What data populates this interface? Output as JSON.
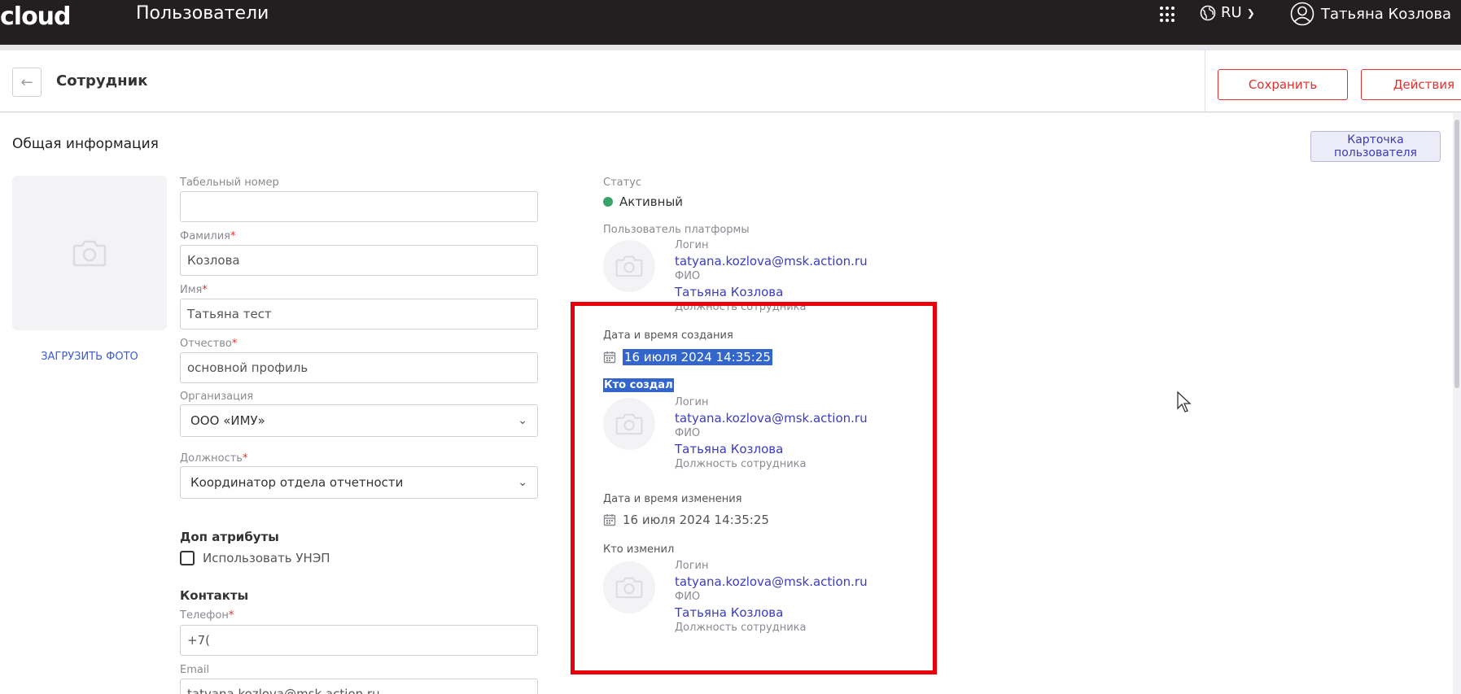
{
  "topbar": {
    "logo_text": "cloud",
    "page_title": "Пользователи",
    "language": "RU",
    "user_name": "Татьяна Козлова",
    "icons": {
      "apps": "apps-grid-icon",
      "language": "globe-icon",
      "user": "user-circle-icon"
    }
  },
  "header": {
    "title": "Сотрудник",
    "save_label": "Сохранить",
    "actions_label": "Действия",
    "back_icon": "arrow-left-icon"
  },
  "general": {
    "section_title": "Общая информация",
    "card_button_label": "Карточка пользователя",
    "upload_photo_label": "ЗАГРУЗИТЬ ФОТО",
    "photo_icon": "camera-icon"
  },
  "fields": {
    "tab_number": {
      "label": "Табельный номер",
      "value": ""
    },
    "last_name": {
      "label": "Фамилия",
      "value": "Козлова"
    },
    "first_name": {
      "label": "Имя",
      "value": "Татьяна тест"
    },
    "middle_name": {
      "label": "Отчество",
      "value": "основной профиль"
    },
    "organization": {
      "label": "Организация",
      "value": "ООО «ИМУ»"
    },
    "position": {
      "label": "Должность",
      "value": "Координатор отдела отчетности"
    },
    "required_mark": "*"
  },
  "extra": {
    "title": "Доп атрибуты",
    "use_unep_label": "Использовать УНЭП",
    "use_unep_checked": false
  },
  "contacts": {
    "title": "Контакты",
    "phone_label": "Телефон",
    "phone_value": "+7(",
    "email_label": "Email",
    "email_value": "tatyana.kozlova@msk.action.ru"
  },
  "status": {
    "label": "Статус",
    "value": "Активный",
    "color": "#3aa36b"
  },
  "platform_user": {
    "label": "Пользователь платформы",
    "login_label": "Логин",
    "login": "tatyana.kozlova@msk.action.ru",
    "fio_label": "ФИО",
    "fio": "Татьяна Козлова",
    "position_label": "Должность сотрудника"
  },
  "created": {
    "date_label": "Дата и время создания",
    "date_value": "16 июля 2024 14:35:25",
    "who_label": "Кто создал",
    "login_label": "Логин",
    "login": "tatyana.kozlova@msk.action.ru",
    "fio_label": "ФИО",
    "fio": "Татьяна Козлова",
    "position_label": "Должность сотрудника"
  },
  "modified": {
    "date_label": "Дата и время изменения",
    "date_value": "16 июля 2024 14:35:25",
    "who_label": "Кто изменил",
    "login_label": "Логин",
    "login": "tatyana.kozlova@msk.action.ru",
    "fio_label": "ФИО",
    "fio": "Татьяна Козлова",
    "position_label": "Должность сотрудника"
  },
  "colors": {
    "accent_red": "#e0312d",
    "link_blue": "#3b3bc5",
    "topbar_bg": "#231f20",
    "highlight_red": "#e8000b",
    "selection_blue": "#3366cc"
  }
}
